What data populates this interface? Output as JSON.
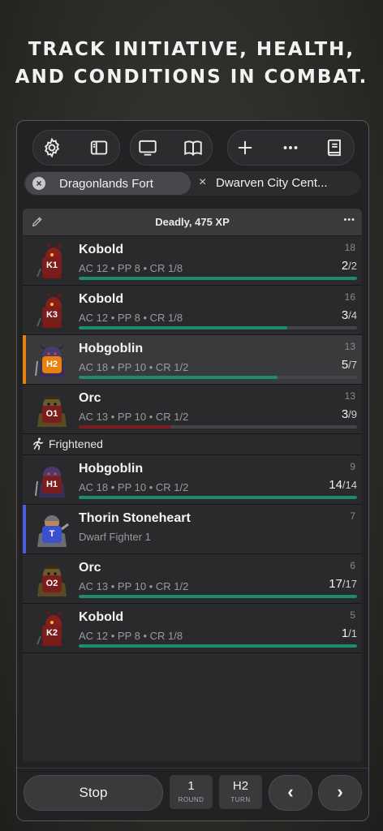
{
  "headline": {
    "line1": "TRACK INITIATIVE, HEALTH,",
    "line2": "AND CONDITIONS IN COMBAT."
  },
  "toolbar": {
    "icons": [
      "gear-icon",
      "sidebar-icon",
      "monitor-icon",
      "book-open-icon",
      "plus-icon",
      "ellipsis-icon",
      "book-icon"
    ]
  },
  "tabs": [
    {
      "label": "Dragonlands Fort",
      "active": true
    },
    {
      "label": "Dwarven City Cent...",
      "active": false
    }
  ],
  "encounter": {
    "difficulty": "Deadly, 475 XP",
    "more": "•••"
  },
  "combatants": [
    {
      "name": "Kobold",
      "stats": "AC 12 • PP 8 • CR 1/8",
      "init": "18",
      "hp": "2",
      "max": "/2",
      "hp_fraction": 1.0,
      "tag": "K1",
      "tag_color": "#7a1d1d",
      "bar_color": "#1e8a6e",
      "creature": "kobold"
    },
    {
      "name": "Kobold",
      "stats": "AC 12 • PP 8 • CR 1/8",
      "init": "16",
      "hp": "3",
      "max": "/4",
      "hp_fraction": 0.75,
      "tag": "K3",
      "tag_color": "#7a1d1d",
      "bar_color": "#1e8a6e",
      "creature": "kobold"
    },
    {
      "name": "Hobgoblin",
      "stats": "AC 18 • PP 10 • CR 1/2",
      "init": "13",
      "hp": "5",
      "max": "/7",
      "hp_fraction": 0.714,
      "tag": "H2",
      "tag_color": "#e8820f",
      "bar_color": "#1e8a6e",
      "creature": "hobgoblin",
      "active": true,
      "turn_color": "#e8820f"
    },
    {
      "name": "Orc",
      "stats": "AC 13 • PP 10 • CR 1/2",
      "init": "13",
      "hp": "3",
      "max": "/9",
      "hp_fraction": 0.333,
      "tag": "O1",
      "tag_color": "#7a1d1d",
      "bar_color": "#7a1d1d",
      "creature": "orc",
      "condition": "Frightened"
    },
    {
      "name": "Hobgoblin",
      "stats": "AC 18 • PP 10 • CR 1/2",
      "init": "9",
      "hp": "14",
      "max": "/14",
      "hp_fraction": 1.0,
      "tag": "H1",
      "tag_color": "#7a1d1d",
      "bar_color": "#1e8a6e",
      "creature": "hobgoblin"
    },
    {
      "name": "Thorin Stoneheart",
      "stats": "Dwarf Fighter 1",
      "init": "7",
      "tag": "T",
      "tag_color": "#3b4fd0",
      "creature": "dwarf",
      "player": true,
      "turn_color": "#4a5fe0"
    },
    {
      "name": "Orc",
      "stats": "AC 13 • PP 10 • CR 1/2",
      "init": "6",
      "hp": "17",
      "max": "/17",
      "hp_fraction": 1.0,
      "tag": "O2",
      "tag_color": "#7a1d1d",
      "bar_color": "#1e8a6e",
      "creature": "orc"
    },
    {
      "name": "Kobold",
      "stats": "AC 12 • PP 8 • CR 1/8",
      "init": "5",
      "hp": "1",
      "max": "/1",
      "hp_fraction": 1.0,
      "tag": "K2",
      "tag_color": "#7a1d1d",
      "bar_color": "#1e8a6e",
      "creature": "kobold"
    }
  ],
  "controls": {
    "stop_label": "Stop",
    "round_value": "1",
    "round_label": "ROUND",
    "turn_value": "H2",
    "turn_label": "TURN",
    "prev": "‹",
    "next": "›"
  }
}
